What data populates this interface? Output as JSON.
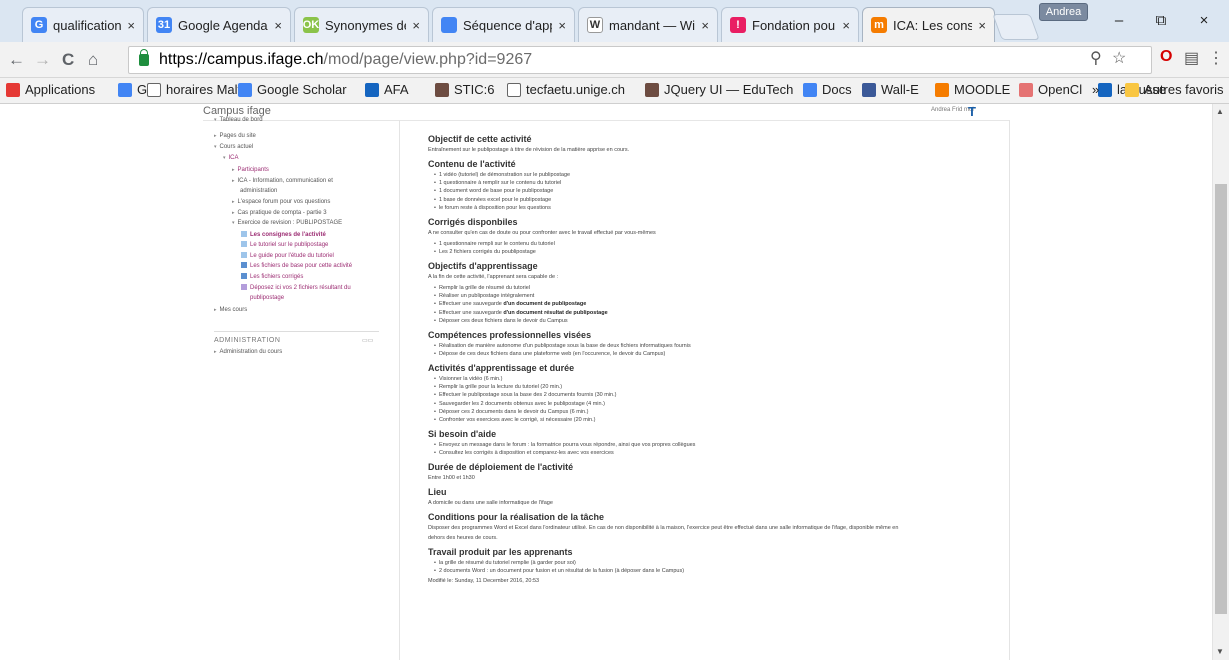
{
  "browser": {
    "tabs": [
      {
        "label": "qualification+ - ",
        "favicon": "G",
        "color": "#4285f4"
      },
      {
        "label": "Google Agenda",
        "favicon": "31",
        "color": "#4285f4"
      },
      {
        "label": "Synonymes de",
        "favicon": "OK",
        "color": "#8bc34a"
      },
      {
        "label": "Séquence d'app",
        "favicon": "",
        "color": "#4285f4"
      },
      {
        "label": "mandant — Wi",
        "favicon": "W",
        "color": "#ffffff"
      },
      {
        "label": "Fondation pour",
        "favicon": "!",
        "color": "#e91e63"
      },
      {
        "label": "ICA: Les consigi",
        "favicon": "m",
        "color": "#f57c00"
      }
    ],
    "tab_close": "×",
    "profile_name": "Andrea",
    "window": {
      "minimize": "–",
      "maximize": "⧉",
      "close": "×"
    },
    "nav": {
      "back": "←",
      "forward": "→",
      "reload": "C",
      "home": "⌂"
    },
    "url": {
      "host": "https://campus.ifage.ch",
      "path": "/mod/page/view.php?id=9267"
    },
    "omni_icons": {
      "zoom": "⚲",
      "star": "☆",
      "ext1": "O",
      "ext2": "▤",
      "menu": "⋮"
    },
    "bookmarks": [
      {
        "label": "Applications",
        "icon": "apps-icon",
        "color": "#e53935"
      },
      {
        "label": "G",
        "icon": "google-icon",
        "color": "#4285f4"
      },
      {
        "label": "horaires Maltt",
        "icon": "page-icon",
        "color": "#ffffff"
      },
      {
        "label": "Google Scholar",
        "icon": "scholar-icon",
        "color": "#4285f4"
      },
      {
        "label": "AFA",
        "icon": "calendar-icon",
        "color": "#1565c0"
      },
      {
        "label": "STIC:6",
        "icon": "bee-icon",
        "color": "#6d4c41"
      },
      {
        "label": "tecfaetu.unige.ch",
        "icon": "page-icon",
        "color": "#ffffff"
      },
      {
        "label": "JQuery UI — EduTech",
        "icon": "bee-icon",
        "color": "#6d4c41"
      },
      {
        "label": "Docs",
        "icon": "docs-icon",
        "color": "#4285f4"
      },
      {
        "label": "Wall-E",
        "icon": "facebook-icon",
        "color": "#3b5998"
      },
      {
        "label": "MOODLE",
        "icon": "moodle-icon",
        "color": "#f57c00"
      },
      {
        "label": "OpenCl",
        "icon": "opencl-icon",
        "color": "#e57373"
      },
      {
        "label": "larousse",
        "icon": "larousse-icon",
        "color": "#1565c0"
      }
    ],
    "bookmarks_more": "»",
    "other_bookmarks": "Autres favoris"
  },
  "site": {
    "name": "Campus ifage",
    "user": "Andrea Frid moi"
  },
  "sidebar": {
    "items": [
      {
        "text": "Tableau de bord",
        "indent": 0,
        "type": "plain",
        "arrow": "▾"
      },
      {
        "text": "Pages du site",
        "indent": 0,
        "type": "plain",
        "arrow": "▸"
      },
      {
        "text": "Cours actuel",
        "indent": 0,
        "type": "plain",
        "arrow": "▾"
      },
      {
        "text": "ICA",
        "indent": 1,
        "type": "link",
        "arrow": "▾"
      },
      {
        "text": "Participants",
        "indent": 2,
        "type": "link",
        "arrow": "▸"
      },
      {
        "text": "ICA - Information, communication et",
        "indent": 2,
        "type": "plain",
        "arrow": "▸"
      },
      {
        "text": "administration",
        "indent": 2,
        "type": "plain",
        "arrow": ""
      },
      {
        "text": "L'espace forum pour vos questions",
        "indent": 2,
        "type": "plain",
        "arrow": "▸"
      },
      {
        "text": "Cas pratique de compta - partie 3",
        "indent": 2,
        "type": "plain",
        "arrow": "▸"
      },
      {
        "text": "Exercice de revision : PUBLIPOSTAGE",
        "indent": 2,
        "type": "plain",
        "arrow": "▾"
      },
      {
        "text": "Les consignes de l'activité",
        "indent": 3,
        "type": "current",
        "arrow": ""
      },
      {
        "text": "Le tutoriel sur le publipostage",
        "indent": 3,
        "type": "link",
        "arrow": ""
      },
      {
        "text": "Le guide pour l'étude du tutoriel",
        "indent": 3,
        "type": "link",
        "arrow": ""
      },
      {
        "text": "Les fichiers de base pour cette activité",
        "indent": 3,
        "type": "link",
        "arrow": ""
      },
      {
        "text": "Les fichiers corrigés",
        "indent": 3,
        "type": "link",
        "arrow": ""
      },
      {
        "text": "Déposez ici vos 2 fichiers résultant du",
        "indent": 3,
        "type": "link",
        "arrow": ""
      },
      {
        "text": "publipostage",
        "indent": 3,
        "type": "link",
        "arrow": ""
      },
      {
        "text": "Mes cours",
        "indent": 0,
        "type": "plain",
        "arrow": "▸"
      }
    ]
  },
  "admin": {
    "title": "ADMINISTRATION",
    "controls": "▭▭",
    "item": "Administration du cours"
  },
  "content": {
    "lines": [
      {
        "kind": "h",
        "text": "Objectif de cette activité"
      },
      {
        "kind": "p",
        "text": "Entraînement sur le publipostage à titre de révision de la matière apprise en cours."
      },
      {
        "kind": "h",
        "text": "Contenu de l'activité"
      },
      {
        "kind": "li",
        "text": "1 vidéo (tutoriel) de démonstration sur le publipostage"
      },
      {
        "kind": "li",
        "text": "1 questionnaire à remplir sur le contenu du tutoriel"
      },
      {
        "kind": "li",
        "text": "1 document word de base pour le publipostage"
      },
      {
        "kind": "li",
        "text": "1 base de données excel pour le publipostage"
      },
      {
        "kind": "li",
        "text": "le forum reste à disposition pour les questions"
      },
      {
        "kind": "h",
        "text": "Corrigés disponbiles"
      },
      {
        "kind": "p",
        "text": "A ne consulter qu'en cas de doute ou pour confronter avec le travail effectué par vous-mêmes"
      },
      {
        "kind": "li",
        "text": "1 questionnaire rempli sur le contenu du tutoriel"
      },
      {
        "kind": "li",
        "text": "Les 2 fichiers corrigés du poublipostage"
      },
      {
        "kind": "h",
        "text": "Objectifs d'apprentissage"
      },
      {
        "kind": "p",
        "text": "A la fin de cette activité, l'apprenant sera capable de :"
      },
      {
        "kind": "li",
        "text": "Remplir la grille de résumé du tutoriel"
      },
      {
        "kind": "li",
        "text": "Réaliser un publipostage intégralement"
      },
      {
        "kind": "li",
        "text": "Effectuer une sauvegarde ",
        "bold": "d'un document de publipostage"
      },
      {
        "kind": "li",
        "text": "Effectuer une sauvegarde ",
        "bold": "d'un document résultat de publipostage"
      },
      {
        "kind": "li",
        "text": "Déposer ces deux fichiers dans le devoir du Campus"
      },
      {
        "kind": "h",
        "text": "Compétences professionnelles visées"
      },
      {
        "kind": "li",
        "text": "Réalisation de manière autonome d'un publipostage sous la base de deux fichiers informatiques fournis"
      },
      {
        "kind": "li",
        "text": "Dépose de ces deux fichiers dans une plateforme web (en l'occurence, le devoir du Campus)"
      },
      {
        "kind": "h",
        "text": "Activités d'apprentissage et durée"
      },
      {
        "kind": "li",
        "text": "Visionner la vidéo (6 min.)"
      },
      {
        "kind": "li",
        "text": "Remplir la grille pour la lecture du tutoriel (20 min.)"
      },
      {
        "kind": "li",
        "text": "Effectuer le publipostage sous la base des 2 documents fournis (30 min.)"
      },
      {
        "kind": "li",
        "text": "Sauvegarder les 2 documents obtenus avec le publipostage (4 min.)"
      },
      {
        "kind": "li",
        "text": "Déposer ces 2 documents dans le devoir du Campus (6 min.)"
      },
      {
        "kind": "li",
        "text": "Confronter vos exercices avec le corrigé, si nécessaire (20 min.)"
      },
      {
        "kind": "h",
        "text": "Si besoin d'aide"
      },
      {
        "kind": "li",
        "text": "Envoyez un message dans le forum : la formatrice pourra vous répondre, ainsi que vos propres collègues"
      },
      {
        "kind": "li",
        "text": "Consultez les corrigés à disposition et comparez-les avec vos exercices"
      },
      {
        "kind": "h",
        "text": "Durée de déploiement de l'activité"
      },
      {
        "kind": "p",
        "text": "Entre 1h00 et 1h30"
      },
      {
        "kind": "h",
        "text": "Lieu"
      },
      {
        "kind": "p",
        "text": "A domicile ou dans une salle informatique de l'ifage"
      },
      {
        "kind": "h",
        "text": "Conditions pour la réalisation de la tâche"
      },
      {
        "kind": "p",
        "text": "Disposer des programmes Word et Excel dans l'ordinateur utilisé. En cas de non disponibilité à la maison, l'exercice peut être effectué dans une salle informatique de l'ifage, disponible même en"
      },
      {
        "kind": "p",
        "text": "dehors des heures de cours."
      },
      {
        "kind": "h",
        "text": "Travail produit par les apprenants"
      },
      {
        "kind": "li",
        "text": "la grille de résumé du tutoriel remplie (à garder pour soi)"
      },
      {
        "kind": "li",
        "text": "2 documents Word : un document pour fusion et un résultat de la fusion (à déposer dans le Campus)"
      },
      {
        "kind": "p",
        "text": "Modifié le: Sunday, 11 December 2016, 20:53"
      }
    ]
  }
}
